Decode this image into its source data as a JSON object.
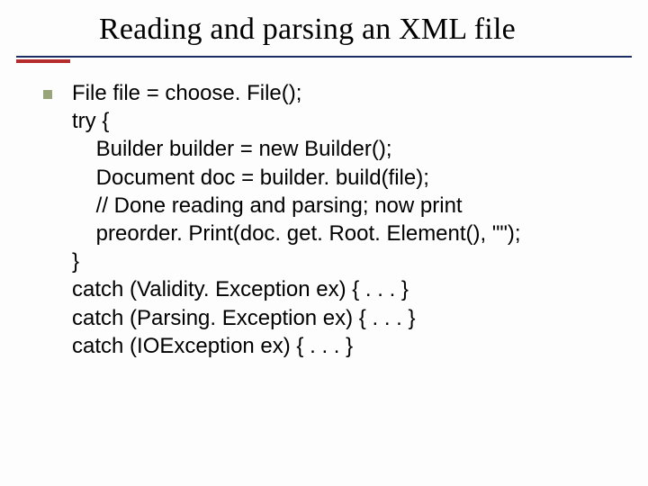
{
  "slide": {
    "title": "Reading and parsing an XML file",
    "code_lines": {
      "l0": "File file = choose. File();",
      "l1": "try {",
      "l2": "    Builder builder = new Builder();",
      "l3": "    Document doc = builder. build(file);",
      "l4": "    // Done reading and parsing; now print",
      "l5": "    preorder. Print(doc. get. Root. Element(), \"\");",
      "l6": "}",
      "l7": "catch (Validity. Exception ex) { . . . }",
      "l8": "catch (Parsing. Exception ex) { . . . }",
      "l9": "catch (IOException ex) { . . . }"
    }
  }
}
